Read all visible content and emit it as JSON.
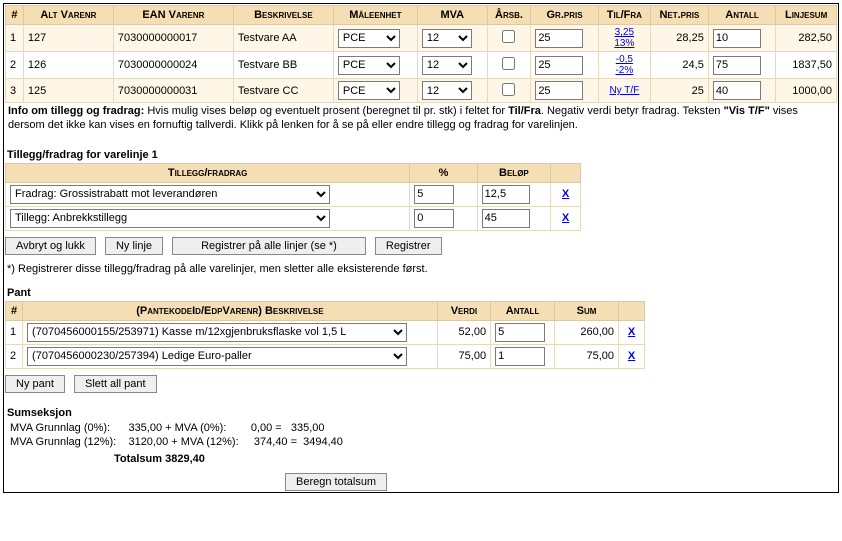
{
  "lines_header": {
    "num": "#",
    "alt": "Alt Varenr",
    "ean": "EAN Varenr",
    "beskr": "Beskrivelse",
    "enhet": "Måleenhet",
    "mva": "MVA",
    "arsb": "Årsb.",
    "grpris": "Gr.pris",
    "tilfra": "Til/Fra",
    "netpris": "Net.pris",
    "antall": "Antall",
    "linjesum": "Linjesum"
  },
  "unit_options": [
    "PCE"
  ],
  "mva_options": [
    "12"
  ],
  "lines": [
    {
      "n": "1",
      "alt": "127",
      "ean": "7030000000017",
      "beskr": "Testvare AA",
      "enhet": "PCE",
      "mva": "12",
      "arsb": false,
      "grpris": "25",
      "tilfra_a": "3,25",
      "tilfra_b": "13%",
      "netpris": "28,25",
      "antall": "10",
      "sum": "282,50"
    },
    {
      "n": "2",
      "alt": "126",
      "ean": "7030000000024",
      "beskr": "Testvare BB",
      "enhet": "PCE",
      "mva": "12",
      "arsb": false,
      "grpris": "25",
      "tilfra_a": "-0,5",
      "tilfra_b": "-2%",
      "netpris": "24,5",
      "antall": "75",
      "sum": "1837,50"
    },
    {
      "n": "3",
      "alt": "125",
      "ean": "7030000000031",
      "beskr": "Testvare CC",
      "enhet": "PCE",
      "mva": "12",
      "arsb": false,
      "grpris": "25",
      "tilfra_ny": "Ny T/F",
      "netpris": "25",
      "antall": "40",
      "sum": "1000,00"
    }
  ],
  "info": {
    "lead": "Info om tillegg og fradrag:",
    "body1": " Hvis mulig vises beløp og eventuelt prosent (beregnet til pr. stk) i feltet for ",
    "tf": "Til/Fra",
    "body2": ". Negativ verdi betyr fradrag. Teksten ",
    "vis": "\"Vis T/F\"",
    "body3": " vises dersom det ikke kan vises en fornuftig tallverdi. Klikk på lenken for å se på eller endre tillegg og fradrag for varelinjen."
  },
  "tf_section_title": "Tillegg/fradrag for varelinje 1",
  "tf_header": {
    "a": "Tillegg/fradrag",
    "b": "%",
    "c": "Beløp"
  },
  "tf_rows": [
    {
      "opt": "Fradrag: Grossistrabatt mot leverandøren",
      "pct": "5",
      "bel": "12,5",
      "x": "X"
    },
    {
      "opt": "Tillegg: Anbrekkstillegg",
      "pct": "0",
      "bel": "45",
      "x": "X"
    }
  ],
  "tf_buttons": {
    "avbryt": "Avbryt og lukk",
    "ny": "Ny linje",
    "regalle": "Registrer på alle linjer (se *)",
    "reg": "Registrer"
  },
  "tf_note": "*) Registrerer disse tillegg/fradrag på alle varelinjer, men sletter alle eksisterende først.",
  "pant_title": "Pant",
  "pant_header": {
    "n": "#",
    "b": "(PantekodeId/EdpVarenr) Beskrivelse",
    "v": "Verdi",
    "a": "Antall",
    "s": "Sum"
  },
  "pant_rows": [
    {
      "n": "1",
      "opt": "(7070456000155/253971) Kasse m/12xgjenbruksflaske vol 1,5 L",
      "v": "52,00",
      "a": "5",
      "s": "260,00",
      "x": "X"
    },
    {
      "n": "2",
      "opt": "(7070456000230/257394) Ledige Euro-paller",
      "v": "75,00",
      "a": "1",
      "s": "75,00",
      "x": "X"
    }
  ],
  "pant_buttons": {
    "ny": "Ny pant",
    "slett": "Slett all pant"
  },
  "sum_title": "Sumseksjon",
  "sum_lines": [
    " MVA Grunnlag (0%):      335,00 + MVA (0%):        0,00 =   335,00",
    " MVA Grunnlag (12%):    3120,00 + MVA (12%):     374,40 =  3494,40"
  ],
  "sum_total": "                                   Totalsum 3829,40",
  "calc_button": "Beregn totalsum"
}
